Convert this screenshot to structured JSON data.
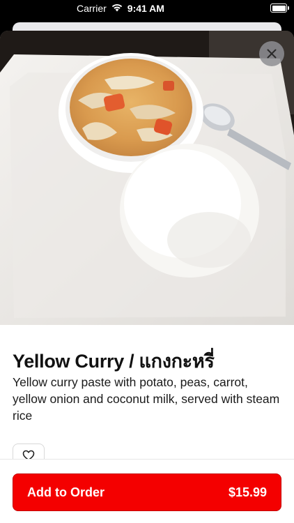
{
  "status_bar": {
    "carrier": "Carrier",
    "time": "9:41 AM",
    "wifi_icon": "wifi-icon",
    "battery_icon": "battery-icon",
    "battery_level": 1.0
  },
  "item": {
    "title": "Yellow Curry / แกงกะหรี่",
    "description": "Yellow curry paste with potato, peas, carrot, yellow onion and coconut milk, served with steam rice",
    "image": "yellow-curry-with-rice-photo"
  },
  "actions": {
    "close_icon": "close-icon",
    "favorite_icon": "heart-icon",
    "add_label": "Add to Order",
    "price": "$15.99"
  },
  "colors": {
    "accent": "#f40000",
    "text": "#111111",
    "close_button": "#8e8e93"
  }
}
